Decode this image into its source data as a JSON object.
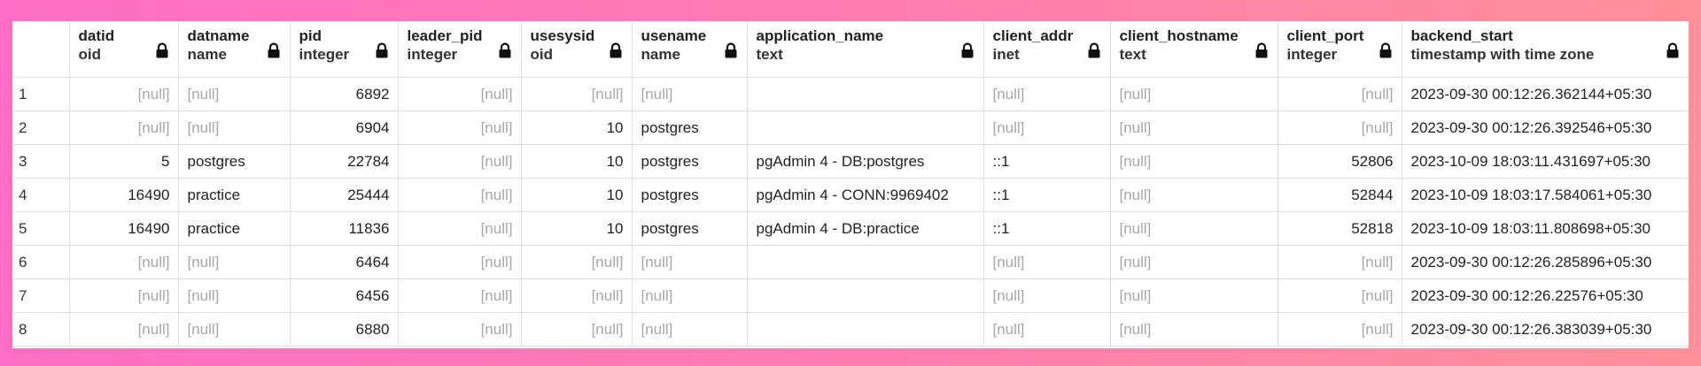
{
  "columns": [
    {
      "name": "datid",
      "type": "oid",
      "align": "num"
    },
    {
      "name": "datname",
      "type": "name",
      "align": "txt"
    },
    {
      "name": "pid",
      "type": "integer",
      "align": "num"
    },
    {
      "name": "leader_pid",
      "type": "integer",
      "align": "num"
    },
    {
      "name": "usesysid",
      "type": "oid",
      "align": "num"
    },
    {
      "name": "usename",
      "type": "name",
      "align": "txt"
    },
    {
      "name": "application_name",
      "type": "text",
      "align": "txt"
    },
    {
      "name": "client_addr",
      "type": "inet",
      "align": "txt"
    },
    {
      "name": "client_hostname",
      "type": "text",
      "align": "txt"
    },
    {
      "name": "client_port",
      "type": "integer",
      "align": "num"
    },
    {
      "name": "backend_start",
      "type": "timestamp with time zone",
      "align": "txt"
    }
  ],
  "null_text": "[null]",
  "rows": [
    {
      "num": "1",
      "cells": [
        null,
        null,
        "6892",
        null,
        null,
        null,
        "",
        null,
        null,
        null,
        "2023-09-30 00:12:26.362144+05:30"
      ]
    },
    {
      "num": "2",
      "cells": [
        null,
        null,
        "6904",
        null,
        "10",
        "postgres",
        "",
        null,
        null,
        null,
        "2023-09-30 00:12:26.392546+05:30"
      ]
    },
    {
      "num": "3",
      "cells": [
        "5",
        "postgres",
        "22784",
        null,
        "10",
        "postgres",
        "pgAdmin 4 - DB:postgres",
        "::1",
        null,
        "52806",
        "2023-10-09 18:03:11.431697+05:30"
      ]
    },
    {
      "num": "4",
      "cells": [
        "16490",
        "practice",
        "25444",
        null,
        "10",
        "postgres",
        "pgAdmin 4 - CONN:9969402",
        "::1",
        null,
        "52844",
        "2023-10-09 18:03:17.584061+05:30"
      ]
    },
    {
      "num": "5",
      "cells": [
        "16490",
        "practice",
        "11836",
        null,
        "10",
        "postgres",
        "pgAdmin 4 - DB:practice",
        "::1",
        null,
        "52818",
        "2023-10-09 18:03:11.808698+05:30"
      ]
    },
    {
      "num": "6",
      "cells": [
        null,
        null,
        "6464",
        null,
        null,
        null,
        "",
        null,
        null,
        null,
        "2023-09-30 00:12:26.285896+05:30"
      ]
    },
    {
      "num": "7",
      "cells": [
        null,
        null,
        "6456",
        null,
        null,
        null,
        "",
        null,
        null,
        null,
        "2023-09-30 00:12:26.22576+05:30"
      ]
    },
    {
      "num": "8",
      "cells": [
        null,
        null,
        "6880",
        null,
        null,
        null,
        "",
        null,
        null,
        null,
        "2023-09-30 00:12:26.383039+05:30"
      ]
    }
  ]
}
